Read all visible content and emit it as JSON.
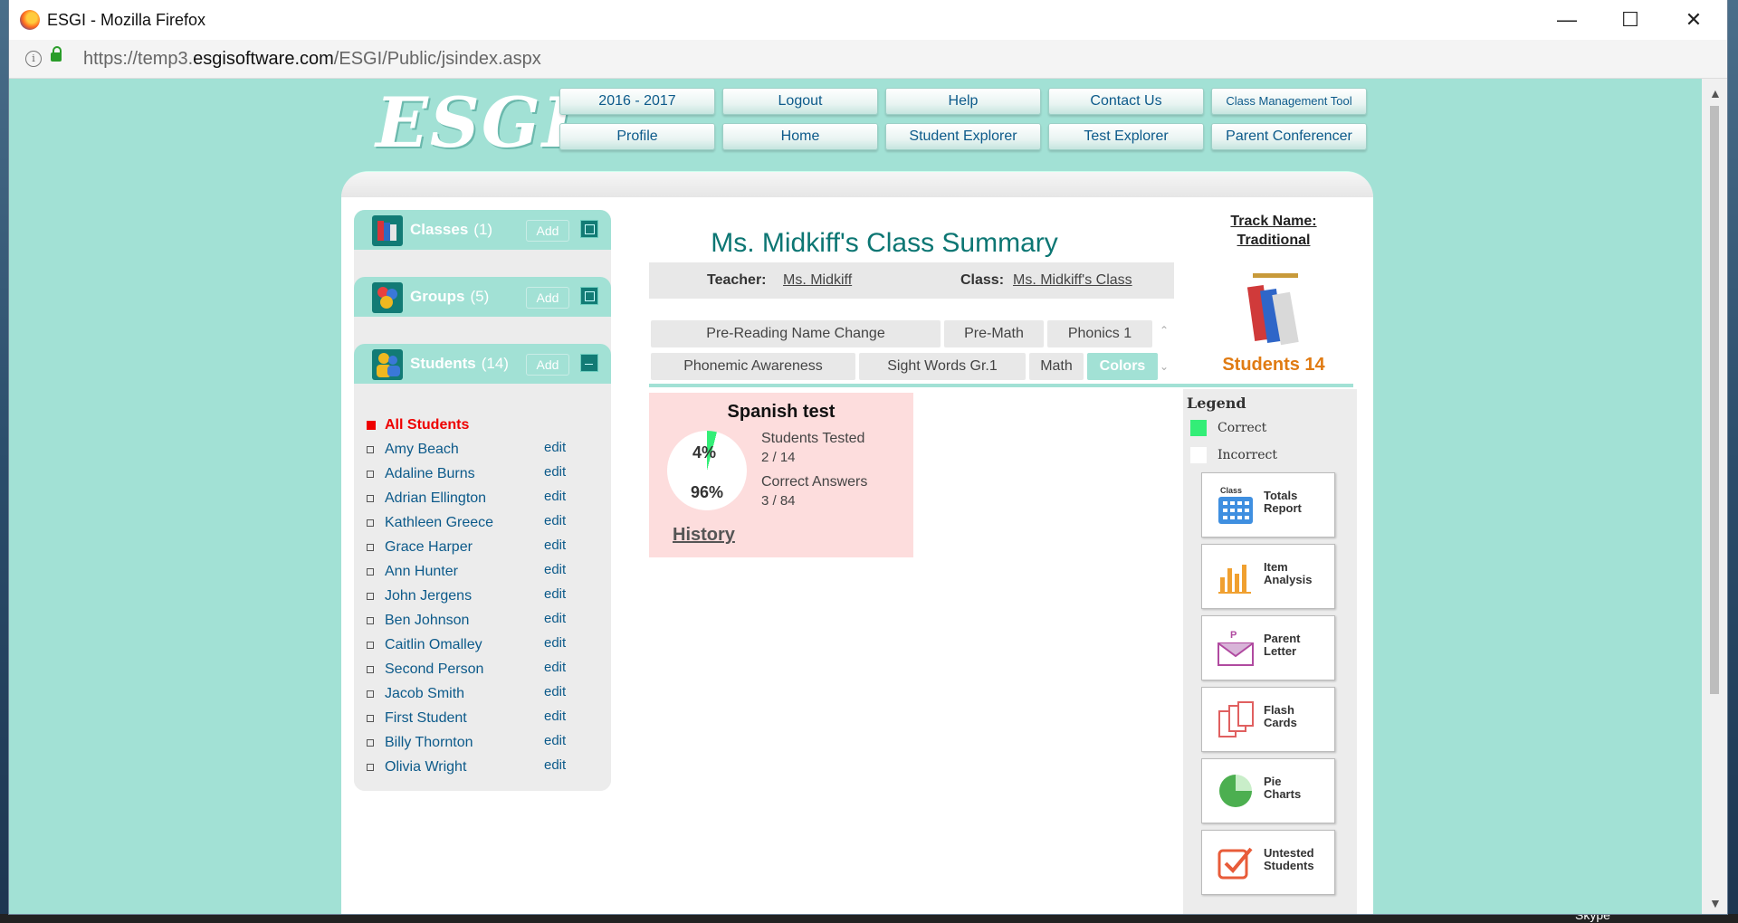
{
  "window": {
    "title": "ESGI - Mozilla Firefox",
    "url_prefix": "https://temp3.",
    "url_domain": "esgisoftware.com",
    "url_path": "/ESGI/Public/jsindex.aspx",
    "minimize_glyph": "—",
    "maximize_glyph": "☐",
    "close_glyph": "✕"
  },
  "app": {
    "logo": "ESGI",
    "nav_row1": [
      "2016 - 2017",
      "Logout",
      "Help",
      "Contact Us",
      "Class Management Tool"
    ],
    "nav_row2": [
      "Profile",
      "Home",
      "Student Explorer",
      "Test Explorer",
      "Parent Conferencer"
    ]
  },
  "sidebar": {
    "classes": {
      "label": "Classes",
      "count": "(1)",
      "add": "Add"
    },
    "groups": {
      "label": "Groups",
      "count": "(5)",
      "add": "Add"
    },
    "students": {
      "label": "Students",
      "count": "(14)",
      "add": "Add"
    },
    "all_students": "All Students",
    "edit_label": "edit",
    "student_list": [
      "Amy Beach",
      "Adaline Burns",
      "Adrian Ellington",
      "Kathleen Greece",
      "Grace Harper",
      "Ann Hunter",
      "John Jergens",
      "Ben Johnson",
      "Caitlin Omalley",
      "Second Person",
      "Jacob Smith",
      "First Student",
      "Billy Thornton",
      "Olivia Wright"
    ]
  },
  "main": {
    "title": "Ms. Midkiff's Class Summary",
    "teacher_label": "Teacher:",
    "teacher_value": "Ms. Midkiff",
    "class_label": "Class:",
    "class_value": "Ms. Midkiff's Class",
    "tabs_row1": [
      "Pre-Reading Name Change",
      "Pre-Math",
      "Phonics 1"
    ],
    "tabs_row2": [
      "Phonemic Awareness",
      "Sight Words Gr.1",
      "Math",
      "Colors"
    ],
    "active_tab": "Colors",
    "test_card": {
      "title": "Spanish test",
      "pie_incorrect_pct": "4%",
      "pie_correct_pct": "96%",
      "pie_fill_fraction": 0.04,
      "students_tested_label": "Students Tested",
      "students_tested_value": "2 / 14",
      "correct_answers_label": "Correct Answers",
      "correct_answers_value": "3 / 84",
      "history": "History"
    }
  },
  "right": {
    "track_line1": "Track Name:",
    "track_line2": "Traditional",
    "students_count": "Students 14",
    "legend_title": "Legend",
    "legend_correct": "Correct",
    "legend_incorrect": "Incorrect",
    "correct_color": "#33ee77",
    "reports": [
      {
        "l1": "Totals",
        "l2": "Report",
        "badge": "Class",
        "icon": "grid-calendar-icon"
      },
      {
        "l1": "Item",
        "l2": "Analysis",
        "icon": "bar-chart-icon"
      },
      {
        "l1": "Parent",
        "l2": "Letter",
        "badge": "P",
        "icon": "envelope-icon"
      },
      {
        "l1": "Flash",
        "l2": "Cards",
        "icon": "flash-cards-icon"
      },
      {
        "l1": "Pie",
        "l2": "Charts",
        "icon": "pie-chart-icon"
      },
      {
        "l1": "Untested",
        "l2": "Students",
        "icon": "checkbox-icon"
      }
    ]
  },
  "desktop": {
    "taskbar_label": "Skype"
  }
}
